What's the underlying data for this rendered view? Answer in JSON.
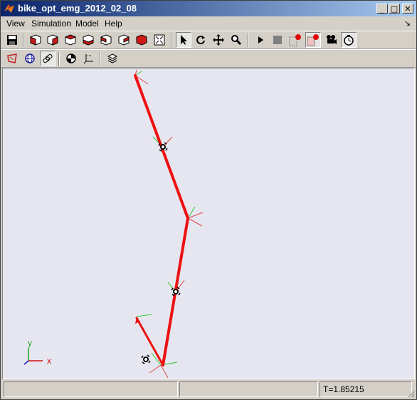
{
  "window": {
    "title": "bike_opt_emg_2012_02_08",
    "minimize_glyph": "_",
    "maximize_glyph": "□",
    "close_glyph": "✕"
  },
  "menu": {
    "items": [
      "View",
      "Simulation",
      "Model",
      "Help"
    ],
    "dock_glyph": "↘"
  },
  "toolbar1": {
    "icons": [
      "save-icon",
      "view-front-icon",
      "view-back-icon",
      "view-left-icon",
      "view-right-icon",
      "view-top-icon",
      "view-bottom-icon",
      "view-fit-icon",
      "pointer-icon",
      "rotate-icon",
      "pan-icon",
      "zoom-icon",
      "play-icon",
      "stop-icon",
      "record-start-icon",
      "record-stop-icon",
      "camera-icon",
      "timer-icon"
    ]
  },
  "toolbar2": {
    "icons": [
      "model-red-icon",
      "globe-icon",
      "link-icon",
      "center-of-mass-icon",
      "axes-icon",
      "layers-icon"
    ]
  },
  "canvas": {
    "background": "#e6e6f0",
    "segment_color": "#ee1111",
    "axis_labels": {
      "y": "y",
      "x": "x"
    }
  },
  "status": {
    "pane1": "",
    "pane2": "",
    "time": "T=1.85215"
  }
}
